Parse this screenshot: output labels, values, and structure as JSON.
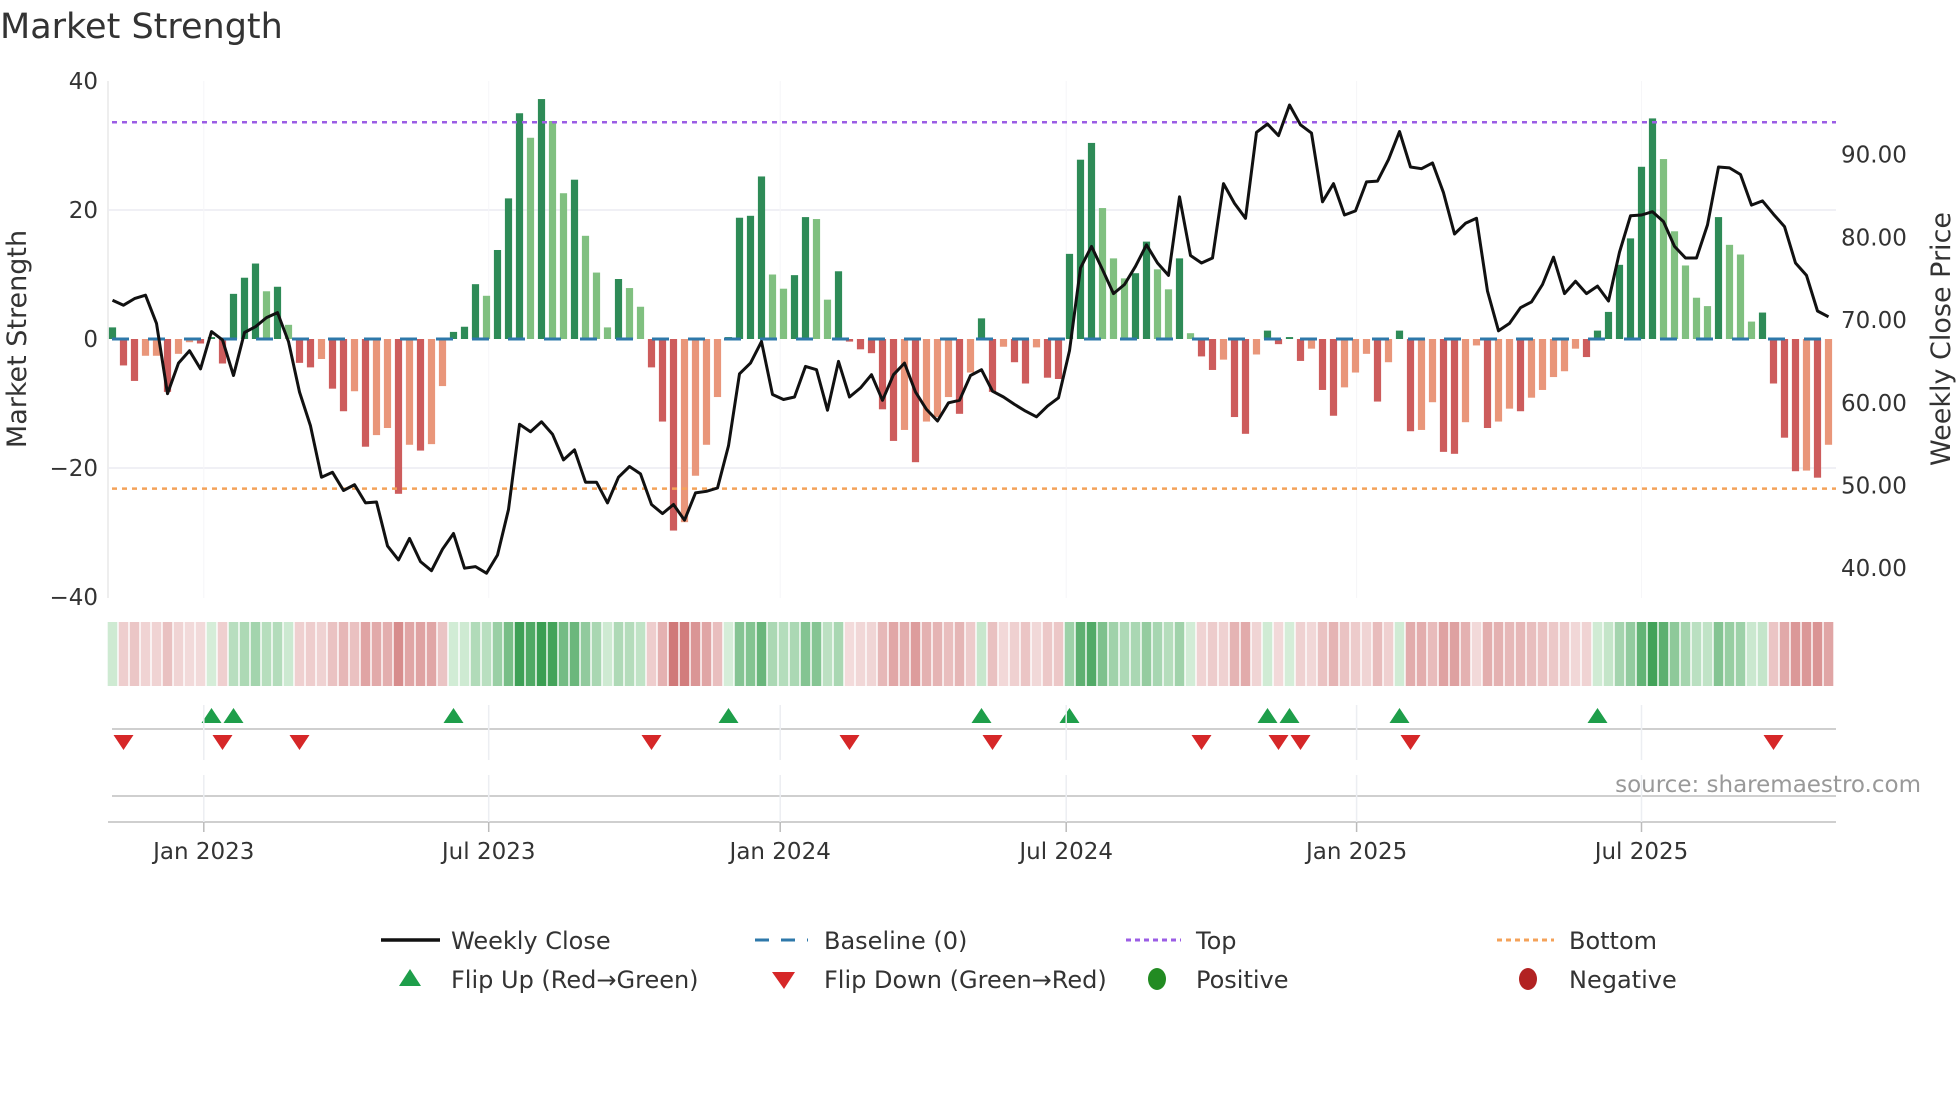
{
  "chart_data": {
    "type": "bar",
    "title": "Market Strength",
    "ylabel": "Market Strength",
    "y2label": "Weekly Close Price",
    "ylim": [
      -40,
      40
    ],
    "y2lim": [
      36.4,
      98.9
    ],
    "yticks": [
      40,
      20,
      0,
      -20,
      -40
    ],
    "ytick_labels": [
      "40",
      "20",
      "0",
      "−20",
      "−40"
    ],
    "y2ticks": [
      90,
      80,
      70,
      60,
      50,
      40
    ],
    "y2tick_labels": [
      "90.00",
      "80.00",
      "70.00",
      "60.00",
      "50.00",
      "40.00"
    ],
    "xticks": [
      {
        "week": 8.3,
        "label": "Jan 2023"
      },
      {
        "week": 34.2,
        "label": "Jul 2023"
      },
      {
        "week": 60.7,
        "label": "Jan 2024"
      },
      {
        "week": 86.7,
        "label": "Jul 2024"
      },
      {
        "week": 113.1,
        "label": "Jan 2025"
      },
      {
        "week": 139.0,
        "label": "Jul 2025"
      }
    ],
    "top_level": 33.6,
    "bottom_level": -23.2,
    "baseline": 0,
    "grid": true,
    "strength": [
      1.8,
      -4.1,
      -6.5,
      -2.6,
      -2.6,
      -8.2,
      -2.3,
      -0.5,
      -0.7,
      0.3,
      -3.8,
      7,
      9.5,
      11.7,
      7.4,
      8.1,
      2.2,
      -3.7,
      -4.4,
      -3.1,
      -7.7,
      -11.2,
      -8.1,
      -16.7,
      -14.9,
      -13.8,
      -24,
      -16.4,
      -17.3,
      -16.3,
      -7.3,
      1.1,
      1.9,
      8.5,
      6.7,
      13.8,
      21.8,
      35,
      31.2,
      37.2,
      33.8,
      22.6,
      24.7,
      16,
      10.3,
      1.8,
      9.3,
      7.9,
      5,
      -4.4,
      -12.8,
      -29.7,
      -28.4,
      -21.2,
      -16.4,
      -9,
      0.3,
      18.8,
      19.1,
      25.2,
      10,
      7.8,
      9.9,
      18.9,
      18.6,
      6.1,
      10.5,
      -0.4,
      -1.6,
      -2.2,
      -10.9,
      -15.8,
      -14.1,
      -19.1,
      -12.8,
      -12.1,
      -9,
      -11.6,
      -5.2,
      3.2,
      -8.2,
      -1.2,
      -3.6,
      -6.9,
      -1.3,
      -6,
      -6.2,
      13.2,
      27.8,
      30.4,
      20.3,
      12.5,
      9.4,
      10.2,
      15.1,
      10.8,
      7.7,
      12.5,
      0.9,
      -2.7,
      -4.8,
      -3.2,
      -12.1,
      -14.7,
      -2.4,
      1.3,
      -0.8,
      0.3,
      -3.4,
      -1.5,
      -7.9,
      -11.9,
      -7.5,
      -5.2,
      -2.3,
      -9.7,
      -3.6,
      1.3,
      -14.3,
      -14.1,
      -9.8,
      -17.5,
      -17.8,
      -12.9,
      -1,
      -13.8,
      -12.8,
      -10.8,
      -11.2,
      -9.1,
      -7.9,
      -5.9,
      -5,
      -1.5,
      -2.8,
      1.3,
      4.2,
      11.5,
      15.6,
      26.7,
      34.2,
      27.9,
      16.7,
      11.4,
      6.4,
      5.1,
      18.9,
      14.6,
      13.1,
      2.7,
      4.1,
      -6.9,
      -15.3,
      -20.5,
      -20.4,
      -21.5,
      -16.4
    ],
    "weekly_close": [
      72.4,
      71.8,
      72.6,
      73.0,
      69.6,
      61.1,
      64.8,
      66.3,
      64.1,
      68.6,
      67.6,
      63.3,
      68.5,
      69.2,
      70.3,
      70.9,
      67.4,
      61.3,
      57.2,
      51.0,
      51.6,
      49.4,
      50.1,
      47.9,
      48.0,
      42.7,
      41.0,
      43.6,
      40.8,
      39.7,
      42.3,
      44.2,
      40.0,
      40.2,
      39.4,
      41.6,
      47.1,
      57.4,
      56.5,
      57.7,
      56.2,
      53.1,
      54.3,
      50.4,
      50.4,
      47.9,
      51.0,
      52.3,
      51.4,
      47.7,
      46.6,
      47.7,
      45.8,
      49.1,
      49.3,
      49.7,
      54.8,
      63.5,
      64.8,
      67.4,
      61.0,
      60.4,
      60.7,
      64.4,
      64.0,
      59.1,
      65.0,
      60.7,
      61.8,
      63.4,
      60.3,
      63.4,
      64.8,
      61.3,
      59.2,
      57.8,
      60.0,
      60.3,
      63.3,
      64.0,
      61.4,
      60.7,
      59.8,
      59.0,
      58.3,
      59.6,
      60.6,
      66.3,
      76.3,
      78.9,
      76.1,
      73.2,
      74.3,
      76.5,
      79.1,
      76.9,
      75.4,
      84.9,
      77.8,
      76.9,
      77.5,
      86.5,
      84.1,
      82.3,
      92.7,
      93.7,
      92.3,
      96.0,
      93.6,
      92.6,
      84.3,
      86.5,
      82.7,
      83.2,
      86.7,
      86.8,
      89.4,
      92.8,
      88.5,
      88.3,
      89.0,
      85.4,
      80.4,
      81.7,
      82.3,
      73.5,
      68.7,
      69.6,
      71.5,
      72.2,
      74.3,
      77.6,
      73.2,
      74.7,
      73.2,
      74.1,
      72.3,
      78.2,
      82.6,
      82.7,
      83.1,
      81.9,
      78.9,
      77.5,
      77.5,
      81.5,
      88.5,
      88.4,
      87.6,
      83.9,
      84.4,
      82.8,
      81.3,
      76.9,
      75.4,
      71.1,
      70.4
    ],
    "flip_up_weeks": [
      9,
      11,
      31,
      56,
      79,
      87,
      105,
      107,
      117,
      135
    ],
    "flip_down_weeks": [
      1,
      10,
      17,
      49,
      67,
      80,
      99,
      106,
      108,
      118,
      151
    ],
    "legend": {
      "placement": "bottom-center",
      "items": [
        {
          "label": "Weekly Close",
          "symbol": "line"
        },
        {
          "label": "Baseline (0)",
          "symbol": "dash"
        },
        {
          "label": "Top",
          "symbol": "dot"
        },
        {
          "label": "Bottom",
          "symbol": "dot"
        },
        {
          "label": "Flip Up (Red→Green)",
          "symbol": "triangle-up"
        },
        {
          "label": "Flip Down (Green→Red)",
          "symbol": "triangle-down"
        },
        {
          "label": "Positive",
          "symbol": "circle"
        },
        {
          "label": "Negative",
          "symbol": "circle"
        }
      ]
    },
    "source": "source: sharemaestro.com"
  },
  "colors": {
    "green_dark": "#2e8b57",
    "green_light": "#80c080",
    "red_dark": "#cd5c5c",
    "red_light": "#e9967a",
    "line": "#111111",
    "baseline": "#2e78aa",
    "top": "#9b5de5",
    "bottom": "#f4a259",
    "flip_up": "#1e9e4a",
    "flip_down": "#d62728",
    "positive": "#228b22",
    "negative": "#b22222"
  }
}
